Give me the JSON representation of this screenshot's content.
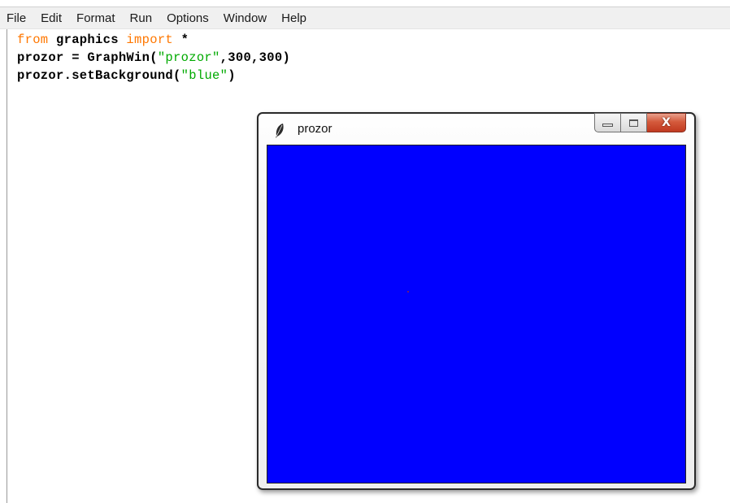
{
  "menu": {
    "items": [
      "File",
      "Edit",
      "Format",
      "Run",
      "Options",
      "Window",
      "Help"
    ]
  },
  "editor": {
    "line1": {
      "kw1": "from",
      "mod": " graphics ",
      "kw2": "import",
      "rest": " *"
    },
    "line2": {
      "pre": "prozor = GraphWin(",
      "str": "\"prozor\"",
      "post": ",300,300)"
    },
    "line3": {
      "pre": "prozor.setBackground(",
      "str": "\"blue\"",
      "post": ")"
    }
  },
  "graph_window": {
    "title": "prozor",
    "close_glyph": "X",
    "background_color": "#0000ff"
  },
  "colors": {
    "keyword": "#ff7700",
    "string": "#00aa00",
    "menubar": "#f0f0f0"
  },
  "icons": [
    "feather-icon",
    "minimize-icon",
    "maximize-icon",
    "close-icon"
  ]
}
